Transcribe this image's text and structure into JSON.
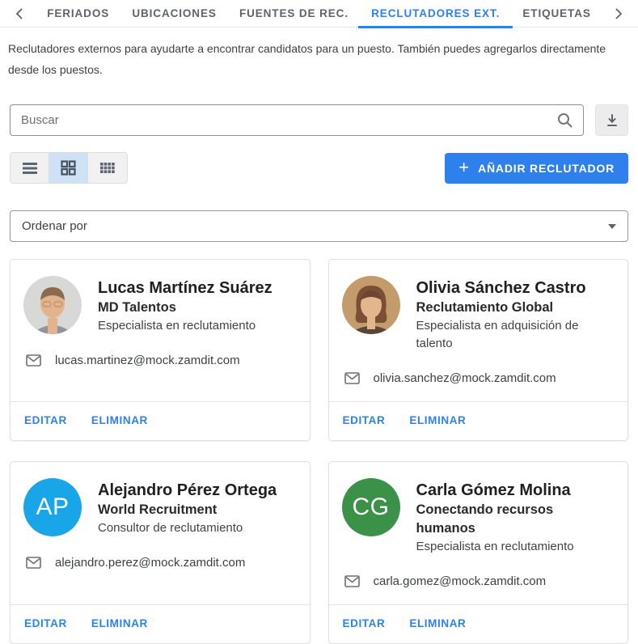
{
  "tabs": {
    "prev_icon": "chevron-left",
    "next_icon": "chevron-right",
    "items": [
      {
        "label": "FERIADOS",
        "active": false
      },
      {
        "label": "UBICACIONES",
        "active": false
      },
      {
        "label": "FUENTES DE REC.",
        "active": false
      },
      {
        "label": "RECLUTADORES EXT.",
        "active": true
      },
      {
        "label": "ETIQUETAS",
        "active": false
      }
    ]
  },
  "description": "Reclutadores externos para ayudarte a encontrar candidatos para un puesto. También puedes agregarlos directamente desde los puestos.",
  "search": {
    "placeholder": "Buscar"
  },
  "toolbar": {
    "add_plus": "+",
    "add_label": "AÑADIR RECLUTADOR",
    "views": [
      "list",
      "grid",
      "table"
    ],
    "selected_view": "grid"
  },
  "sort": {
    "label": "Ordenar por"
  },
  "actions": {
    "edit": "EDITAR",
    "delete": "ELIMINAR"
  },
  "colors": {
    "accent_blue": "#2e80ed",
    "toggle_selected_bg": "#cfe1f7",
    "avatar_blue": "#18a6e8",
    "avatar_green": "#3a9147"
  },
  "recruiters": [
    {
      "name": "Lucas Martínez Suárez",
      "company": "MD Talentos",
      "role": "Especialista en reclutamiento",
      "email": "lucas.martinez@mock.zamdit.com",
      "avatar_type": "photo",
      "photo_variant": "male"
    },
    {
      "name": "Olivia Sánchez Castro",
      "company": "Reclutamiento Global",
      "role": "Especialista en adquisición de talento",
      "email": "olivia.sanchez@mock.zamdit.com",
      "avatar_type": "photo",
      "photo_variant": "female"
    },
    {
      "name": "Alejandro Pérez Ortega",
      "company": "World Recruitment",
      "role": "Consultor de reclutamiento",
      "email": "alejandro.perez@mock.zamdit.com",
      "avatar_type": "initials",
      "initials": "AP",
      "avatar_color": "#18a6e8"
    },
    {
      "name": "Carla Gómez Molina",
      "company": "Conectando recursos humanos",
      "role": "Especialista en reclutamiento",
      "email": "carla.gomez@mock.zamdit.com",
      "avatar_type": "initials",
      "initials": "CG",
      "avatar_color": "#3a9147"
    }
  ]
}
